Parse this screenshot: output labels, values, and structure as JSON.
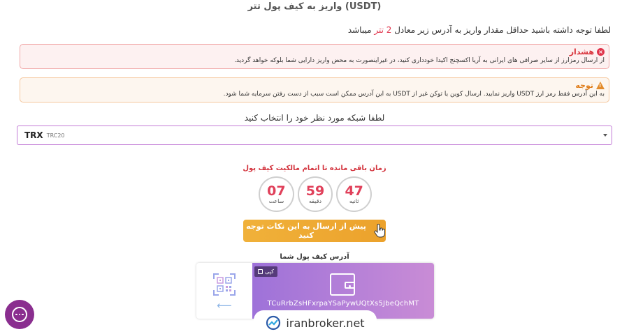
{
  "page": {
    "title": "واریز به کیف پول تتر (USDT)",
    "min_note_prefix": "لطفا توجه داشته باشید حداقل مقدار واریز به آدرس زیر معادل",
    "min_amount": "2 تتر",
    "min_note_suffix": "میباشد"
  },
  "alerts": {
    "danger_title": "هشدار",
    "danger_text": "از ارسال رمزارز از سایر صرافی های ایرانی به آریا اکسچنج اکیدا خودداری کنید، در غیراینصورت به محض واریز دارایی شما بلوکه خواهد گردید.",
    "warning_title": "توجه",
    "warning_text": "به این آدرس فقط رمز ارز USDT واریز نمایید. ارسال کوین یا توکن غیر از USDT به این آدرس ممکن است سبب از دست رفتن سرمایه شما شود."
  },
  "network": {
    "label": "لطفا شبکه مورد نظر خود را انتخاب کنید",
    "selected_main": "TRX",
    "selected_sub": "TRC20"
  },
  "timer": {
    "title": "زمان باقی مانده تا اتمام مالکیت کیف پول",
    "hours": "07",
    "hours_label": "ساعت",
    "minutes": "59",
    "minutes_label": "دقیقه",
    "seconds": "47",
    "seconds_label": "ثانیه"
  },
  "notice_button": {
    "label": "پیش از ارسال به این نکات توجه کنید"
  },
  "wallet": {
    "label": "آدرس کیف پول شما",
    "copy_label": "کپی",
    "address": "TCuRrbZsHFxrpaYSaPywUQtXs5JbeQchMT"
  },
  "brand": {
    "text": "iranbroker.net"
  },
  "colors": {
    "accent": "#e0344b",
    "wallet_grad_start": "#9e72d9",
    "wallet_grad_end": "#c98cd6",
    "button": "#f0b13a"
  }
}
